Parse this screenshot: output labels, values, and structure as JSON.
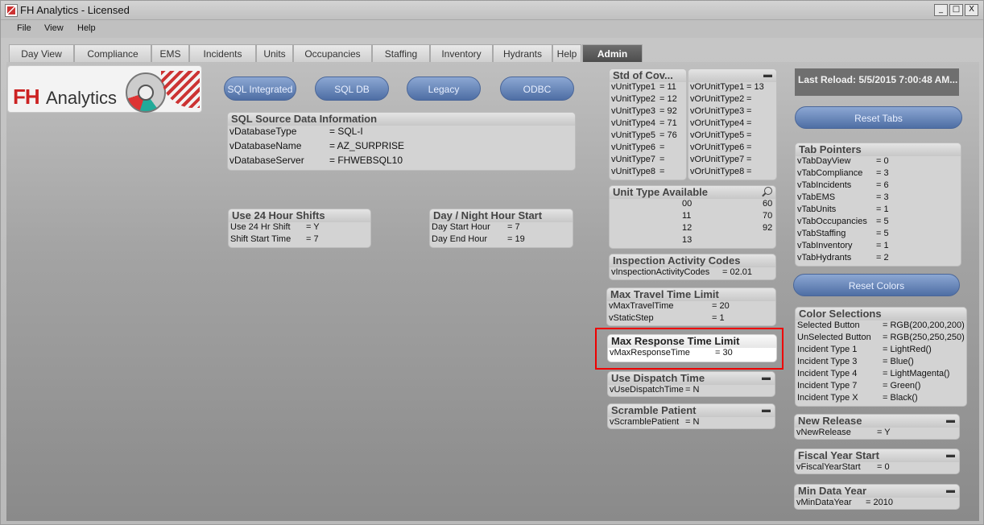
{
  "window": {
    "title": "FH Analytics - Licensed",
    "min_btn": "_",
    "max_btn": "□",
    "close_btn": "X"
  },
  "menu": [
    "File",
    "View",
    "Help"
  ],
  "tabs": [
    "Day View",
    "Compliance",
    "EMS",
    "Incidents",
    "Units",
    "Occupancies",
    "Staffing",
    "Inventory",
    "Hydrants",
    "Help",
    "Admin"
  ],
  "active_tab": "Admin",
  "logo": {
    "fh": "FH",
    "analytics": "Analytics"
  },
  "connection_buttons": [
    "SQL Integrated",
    "SQL DB",
    "Legacy",
    "ODBC"
  ],
  "sql_info": {
    "title": "SQL Source Data Information",
    "rows": [
      {
        "k": "vDatabaseType",
        "v": "= SQL-I"
      },
      {
        "k": "vDatabaseName",
        "v": "= AZ_SURPRISE"
      },
      {
        "k": "vDatabaseServer",
        "v": "= FHWEBSQL10"
      }
    ]
  },
  "shifts": {
    "title": "Use 24 Hour Shifts",
    "rows": [
      {
        "k": "Use 24 Hr Shift",
        "v": "= Y"
      },
      {
        "k": "Shift Start Time",
        "v": "= 7"
      }
    ]
  },
  "daynight": {
    "title": "Day / Night Hour Start",
    "rows": [
      {
        "k": "Day Start Hour",
        "v": "= 7"
      },
      {
        "k": "Day End Hour",
        "v": "= 19"
      }
    ]
  },
  "std_cov": {
    "title": "Std of Cov...",
    "rows": [
      {
        "k": "vUnitType1",
        "v": "= 11"
      },
      {
        "k": "vUnitType2",
        "v": "= 12"
      },
      {
        "k": "vUnitType3",
        "v": "= 92"
      },
      {
        "k": "vUnitType4",
        "v": "= 71"
      },
      {
        "k": "vUnitType5",
        "v": "= 76"
      },
      {
        "k": "vUnitType6",
        "v": "="
      },
      {
        "k": "vUnitType7",
        "v": "="
      },
      {
        "k": "vUnitType8",
        "v": "="
      }
    ]
  },
  "or_unit": {
    "min": "▬",
    "rows": [
      {
        "k": "vOrUnitType1",
        "v": "= 13"
      },
      {
        "k": "vOrUnitType2",
        "v": "="
      },
      {
        "k": "vOrUnitType3",
        "v": "="
      },
      {
        "k": "vOrUnitType4",
        "v": "="
      },
      {
        "k": "vOrUnitType5",
        "v": "="
      },
      {
        "k": "vOrUnitType6",
        "v": "="
      },
      {
        "k": "vOrUnitType7",
        "v": "="
      },
      {
        "k": "vOrUnitType8",
        "v": "="
      }
    ]
  },
  "unit_type_available": {
    "title": "Unit Type Available",
    "col1": [
      "00",
      "11",
      "12",
      "13"
    ],
    "col2": [
      "60",
      "70",
      "92"
    ]
  },
  "inspection": {
    "title": "Inspection Activity Codes",
    "rows": [
      {
        "k": "vInspectionActivityCodes",
        "v": "= 02.01"
      }
    ]
  },
  "max_travel": {
    "title": "Max Travel Time Limit",
    "rows": [
      {
        "k": "vMaxTravelTime",
        "v": "= 20"
      },
      {
        "k": "vStaticStep",
        "v": "= 1"
      }
    ]
  },
  "max_response": {
    "title": "Max Response Time Limit",
    "rows": [
      {
        "k": "vMaxResponseTime",
        "v": "= 30"
      }
    ]
  },
  "dispatch": {
    "title": "Use Dispatch Time",
    "min": "▬",
    "rows": [
      {
        "k": "vUseDispatchTime",
        "v": "= N"
      }
    ]
  },
  "scramble": {
    "title": "Scramble Patient",
    "min": "▬",
    "rows": [
      {
        "k": "vScramblePatient",
        "v": "= N"
      }
    ]
  },
  "last_reload": "Last Reload: 5/5/2015 7:00:48 AM...",
  "reset_tabs": "Reset Tabs",
  "tab_pointers": {
    "title": "Tab Pointers",
    "rows": [
      {
        "k": "vTabDayView",
        "v": "= 0"
      },
      {
        "k": "vTabCompliance",
        "v": "= 3"
      },
      {
        "k": "vTabIncidents",
        "v": "= 6"
      },
      {
        "k": "vTabEMS",
        "v": "= 3"
      },
      {
        "k": "vTabUnits",
        "v": "= 1"
      },
      {
        "k": "vTabOccupancies",
        "v": "= 5"
      },
      {
        "k": "vTabStaffing",
        "v": "= 5"
      },
      {
        "k": "vTabInventory",
        "v": "= 1"
      },
      {
        "k": "vTabHydrants",
        "v": "= 2"
      }
    ]
  },
  "reset_colors": "Reset Colors",
  "color_selections": {
    "title": "Color Selections",
    "rows": [
      {
        "k": "Selected Button",
        "v": "= RGB(200,200,200)"
      },
      {
        "k": "UnSelected Button",
        "v": "= RGB(250,250,250)"
      },
      {
        "k": "Incident Type 1",
        "v": "= LightRed()"
      },
      {
        "k": "Incident Type 3",
        "v": "= Blue()"
      },
      {
        "k": "Incident Type 4",
        "v": "= LightMagenta()"
      },
      {
        "k": "Incident Type 7",
        "v": "= Green()"
      },
      {
        "k": "Incident Type X",
        "v": "= Black()"
      }
    ]
  },
  "new_release": {
    "title": "New Release",
    "min": "▬",
    "rows": [
      {
        "k": "vNewRelease",
        "v": "= Y"
      }
    ]
  },
  "fiscal_year": {
    "title": "Fiscal Year Start",
    "min": "▬",
    "rows": [
      {
        "k": "vFiscalYearStart",
        "v": "= 0"
      }
    ]
  },
  "min_data_year": {
    "title": "Min Data Year",
    "min": "▬",
    "rows": [
      {
        "k": "vMinDataYear",
        "v": "= 2010"
      }
    ]
  }
}
